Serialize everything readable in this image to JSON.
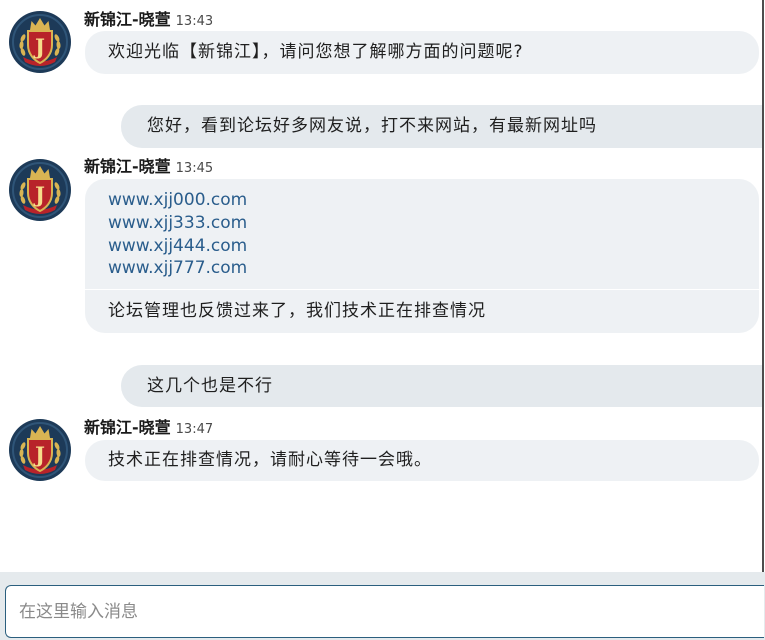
{
  "brand": {
    "logo_letter": "J"
  },
  "colors": {
    "agent_bubble": "#eef1f4",
    "user_bubble": "#e4e9ed",
    "link": "#2a5d8c",
    "input_border": "#2b5f7e",
    "input_area": "#e5eaed",
    "avatar_bg": "#1d3a58",
    "shield_red": "#b8232a",
    "crown_gold": "#d9b453",
    "panel_edge": "#4d4d4d"
  },
  "messages": [
    {
      "sender": "新锦江-晓萱",
      "time": "13:43",
      "text": "欢迎光临【新锦江】，请问您想了解哪方面的问题呢?"
    },
    {
      "text": "您好，看到论坛好多网友说，打不来网站，有最新网址吗"
    },
    {
      "sender": "新锦江-晓萱",
      "time": "13:45",
      "links": [
        "www.xjj000.com",
        "www.xjj333.com",
        "www.xjj444.com",
        "www.xjj777.com"
      ],
      "text": "论坛管理也反馈过来了，我们技术正在排查情况"
    },
    {
      "text": "这几个也是不行"
    },
    {
      "sender": "新锦江-晓萱",
      "time": "13:47",
      "text": "技术正在排查情况，请耐心等待一会哦。"
    }
  ],
  "input": {
    "placeholder": "在这里输入消息"
  }
}
